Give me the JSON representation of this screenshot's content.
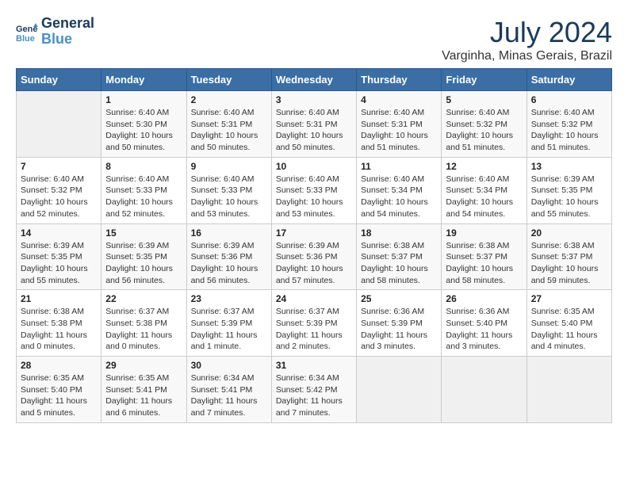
{
  "header": {
    "logo_line1": "General",
    "logo_line2": "Blue",
    "month_year": "July 2024",
    "location": "Varginha, Minas Gerais, Brazil"
  },
  "days_of_week": [
    "Sunday",
    "Monday",
    "Tuesday",
    "Wednesday",
    "Thursday",
    "Friday",
    "Saturday"
  ],
  "weeks": [
    [
      {
        "day": "",
        "info": ""
      },
      {
        "day": "1",
        "info": "Sunrise: 6:40 AM\nSunset: 5:30 PM\nDaylight: 10 hours\nand 50 minutes."
      },
      {
        "day": "2",
        "info": "Sunrise: 6:40 AM\nSunset: 5:31 PM\nDaylight: 10 hours\nand 50 minutes."
      },
      {
        "day": "3",
        "info": "Sunrise: 6:40 AM\nSunset: 5:31 PM\nDaylight: 10 hours\nand 50 minutes."
      },
      {
        "day": "4",
        "info": "Sunrise: 6:40 AM\nSunset: 5:31 PM\nDaylight: 10 hours\nand 51 minutes."
      },
      {
        "day": "5",
        "info": "Sunrise: 6:40 AM\nSunset: 5:32 PM\nDaylight: 10 hours\nand 51 minutes."
      },
      {
        "day": "6",
        "info": "Sunrise: 6:40 AM\nSunset: 5:32 PM\nDaylight: 10 hours\nand 51 minutes."
      }
    ],
    [
      {
        "day": "7",
        "info": "Sunrise: 6:40 AM\nSunset: 5:32 PM\nDaylight: 10 hours\nand 52 minutes."
      },
      {
        "day": "8",
        "info": "Sunrise: 6:40 AM\nSunset: 5:33 PM\nDaylight: 10 hours\nand 52 minutes."
      },
      {
        "day": "9",
        "info": "Sunrise: 6:40 AM\nSunset: 5:33 PM\nDaylight: 10 hours\nand 53 minutes."
      },
      {
        "day": "10",
        "info": "Sunrise: 6:40 AM\nSunset: 5:33 PM\nDaylight: 10 hours\nand 53 minutes."
      },
      {
        "day": "11",
        "info": "Sunrise: 6:40 AM\nSunset: 5:34 PM\nDaylight: 10 hours\nand 54 minutes."
      },
      {
        "day": "12",
        "info": "Sunrise: 6:40 AM\nSunset: 5:34 PM\nDaylight: 10 hours\nand 54 minutes."
      },
      {
        "day": "13",
        "info": "Sunrise: 6:39 AM\nSunset: 5:35 PM\nDaylight: 10 hours\nand 55 minutes."
      }
    ],
    [
      {
        "day": "14",
        "info": "Sunrise: 6:39 AM\nSunset: 5:35 PM\nDaylight: 10 hours\nand 55 minutes."
      },
      {
        "day": "15",
        "info": "Sunrise: 6:39 AM\nSunset: 5:35 PM\nDaylight: 10 hours\nand 56 minutes."
      },
      {
        "day": "16",
        "info": "Sunrise: 6:39 AM\nSunset: 5:36 PM\nDaylight: 10 hours\nand 56 minutes."
      },
      {
        "day": "17",
        "info": "Sunrise: 6:39 AM\nSunset: 5:36 PM\nDaylight: 10 hours\nand 57 minutes."
      },
      {
        "day": "18",
        "info": "Sunrise: 6:38 AM\nSunset: 5:37 PM\nDaylight: 10 hours\nand 58 minutes."
      },
      {
        "day": "19",
        "info": "Sunrise: 6:38 AM\nSunset: 5:37 PM\nDaylight: 10 hours\nand 58 minutes."
      },
      {
        "day": "20",
        "info": "Sunrise: 6:38 AM\nSunset: 5:37 PM\nDaylight: 10 hours\nand 59 minutes."
      }
    ],
    [
      {
        "day": "21",
        "info": "Sunrise: 6:38 AM\nSunset: 5:38 PM\nDaylight: 11 hours\nand 0 minutes."
      },
      {
        "day": "22",
        "info": "Sunrise: 6:37 AM\nSunset: 5:38 PM\nDaylight: 11 hours\nand 0 minutes."
      },
      {
        "day": "23",
        "info": "Sunrise: 6:37 AM\nSunset: 5:39 PM\nDaylight: 11 hours\nand 1 minute."
      },
      {
        "day": "24",
        "info": "Sunrise: 6:37 AM\nSunset: 5:39 PM\nDaylight: 11 hours\nand 2 minutes."
      },
      {
        "day": "25",
        "info": "Sunrise: 6:36 AM\nSunset: 5:39 PM\nDaylight: 11 hours\nand 3 minutes."
      },
      {
        "day": "26",
        "info": "Sunrise: 6:36 AM\nSunset: 5:40 PM\nDaylight: 11 hours\nand 3 minutes."
      },
      {
        "day": "27",
        "info": "Sunrise: 6:35 AM\nSunset: 5:40 PM\nDaylight: 11 hours\nand 4 minutes."
      }
    ],
    [
      {
        "day": "28",
        "info": "Sunrise: 6:35 AM\nSunset: 5:40 PM\nDaylight: 11 hours\nand 5 minutes."
      },
      {
        "day": "29",
        "info": "Sunrise: 6:35 AM\nSunset: 5:41 PM\nDaylight: 11 hours\nand 6 minutes."
      },
      {
        "day": "30",
        "info": "Sunrise: 6:34 AM\nSunset: 5:41 PM\nDaylight: 11 hours\nand 7 minutes."
      },
      {
        "day": "31",
        "info": "Sunrise: 6:34 AM\nSunset: 5:42 PM\nDaylight: 11 hours\nand 7 minutes."
      },
      {
        "day": "",
        "info": ""
      },
      {
        "day": "",
        "info": ""
      },
      {
        "day": "",
        "info": ""
      }
    ]
  ]
}
